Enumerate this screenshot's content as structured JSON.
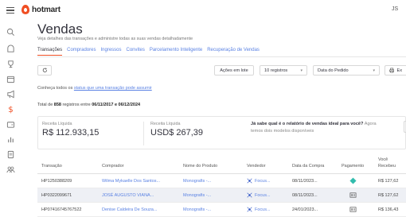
{
  "topbar": {
    "logo_text": "hotmart",
    "user_initials": "JS"
  },
  "sidebar": {
    "icons": [
      "search-icon",
      "home-icon",
      "trophy-icon",
      "calendar-icon",
      "megaphone-icon",
      "dollar-icon",
      "wallet-icon",
      "bar-chart-icon",
      "document-icon",
      "users-icon"
    ]
  },
  "page": {
    "title": "Vendas",
    "subtitle": "Veja detalhes das transações e administre todas as suas vendas detalhadamente"
  },
  "tabs": [
    {
      "label": "Transações",
      "active": true
    },
    {
      "label": "Compradores",
      "active": false
    },
    {
      "label": "Ingressos",
      "active": false
    },
    {
      "label": "Convites",
      "active": false
    },
    {
      "label": "Parcelamento Inteligente",
      "active": false
    },
    {
      "label": "Recuperação de Vendas",
      "active": false
    }
  ],
  "toolbar": {
    "lot_actions": "Ações em lote",
    "records": "10 registros",
    "date_filter": "Data do Pedido",
    "export": "Ex"
  },
  "hint": {
    "text": "Conheça todos os ",
    "link": "status que uma transação pode assumir"
  },
  "total": {
    "prefix": "Total de ",
    "count": "858",
    "middle": " registros entre ",
    "range": "06/11/2017 e 06/12/2024"
  },
  "cards": {
    "brl_label": "Receita Líquida",
    "brl_value": "R$ 112.933,15",
    "usd_label": "Receita Líquida",
    "usd_value": "USD$ 267,39",
    "promo_title": "Já sabe qual é o relatório de vendas ideal para você?",
    "promo_title_tail": " Agora",
    "promo_sub": "temos dois modelos disponíveis"
  },
  "table": {
    "headers": {
      "transaction": "Transação",
      "buyer": "Comprador",
      "product": "Nome do Produto",
      "seller": "Vendedor",
      "date": "Data da Compra",
      "payment": "Pagamento",
      "received_1": "Você",
      "received_2": "Recebeu"
    },
    "rows": [
      {
        "transaction": "HP1250388209",
        "buyer": "Wilma Mykaelle Dos Santos...",
        "product": "Monografis -...",
        "seller": "Focus...",
        "date": "08/11/2023...",
        "payment": "pix-icon",
        "received": "R$ 127,62"
      },
      {
        "transaction": "HP0322099671",
        "buyer": "JOSÉ AUGUSTO VIANA...",
        "product": "Monografis -...",
        "seller": "Focus...",
        "date": "08/11/2023...",
        "payment": "boleto-icon",
        "received": "R$ 127,62"
      },
      {
        "transaction": "HP07416745767522",
        "buyer": "Denise Caldeira De Souza...",
        "product": "Monografis -...",
        "seller": "Focus...",
        "date": "24/01/2023...",
        "payment": "boleto-icon",
        "received": "R$ 136,43"
      }
    ]
  },
  "colors": {
    "accent": "#f04e23",
    "link": "#5981e3",
    "pix": "#32bcad"
  }
}
